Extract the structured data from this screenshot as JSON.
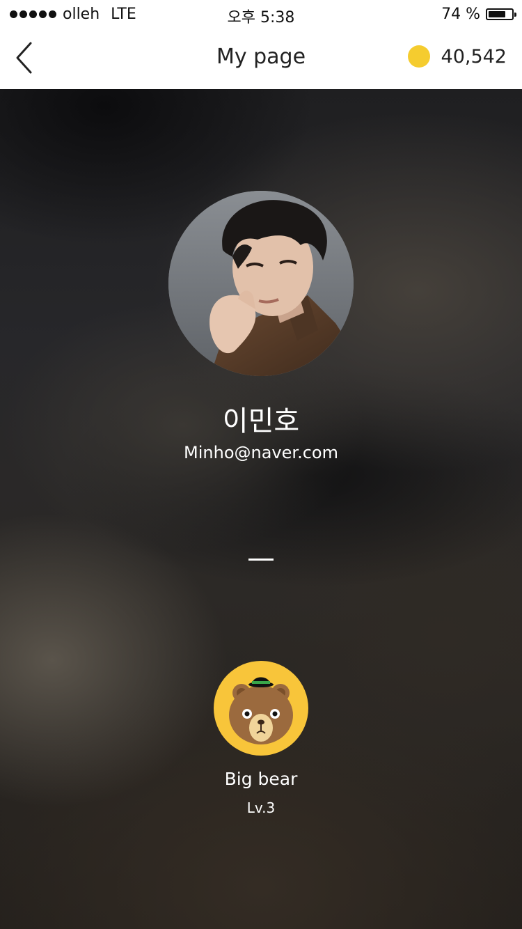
{
  "status_bar": {
    "carrier": "olleh",
    "network": "LTE",
    "time": "오후 5:38",
    "battery_text": "74 %",
    "battery_level": 0.74
  },
  "nav": {
    "title": "My page",
    "coin_count": "40,542",
    "coin_color": "#f5cc2f"
  },
  "profile": {
    "name": "이민호",
    "email": "Minho@naver.com"
  },
  "character": {
    "name": "Big bear",
    "level": "Lv.3",
    "badge_color": "#f8c53a"
  }
}
